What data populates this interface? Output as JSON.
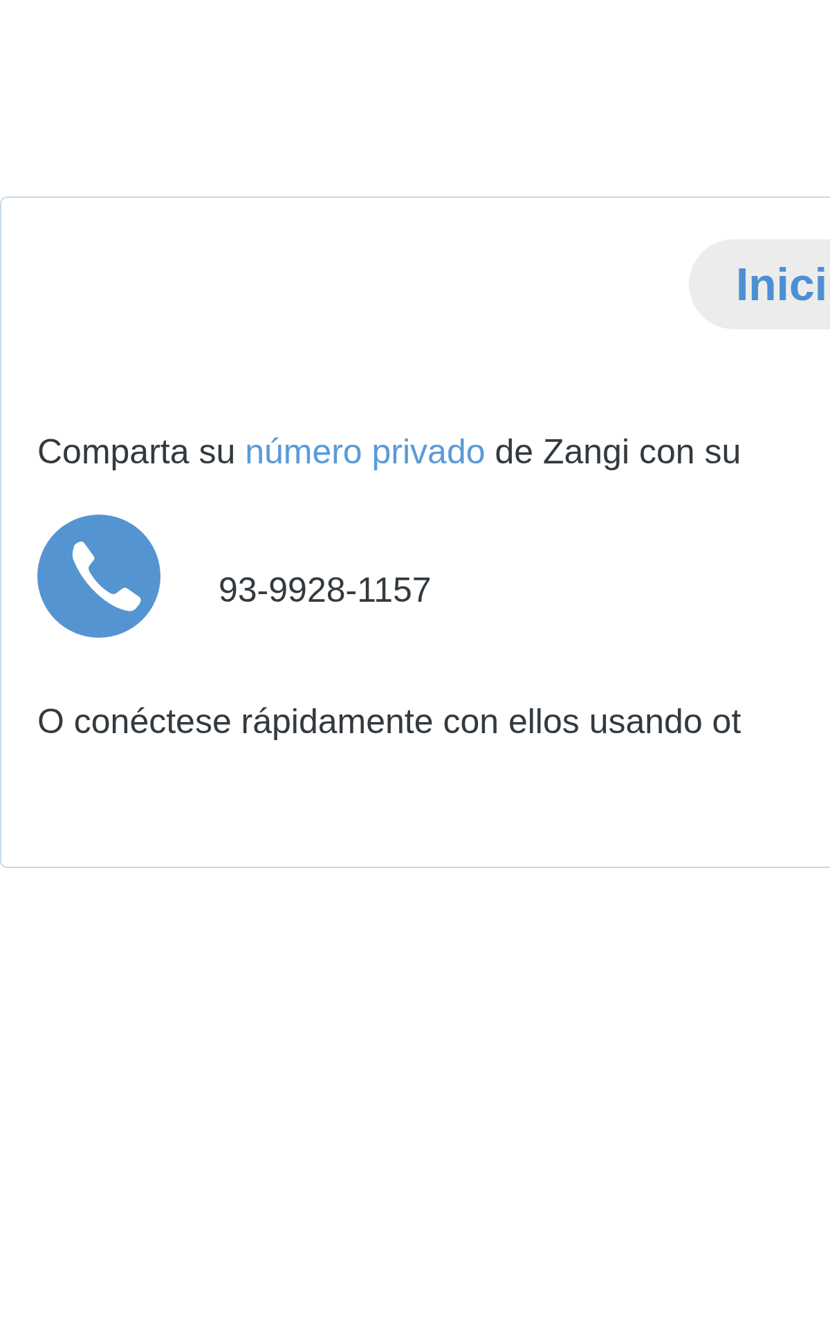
{
  "card": {
    "button": {
      "label": "Inici"
    },
    "share_text": {
      "before": "Comparta su ",
      "link": "número privado",
      "after": " de Zangi con su"
    },
    "phone_number": "93-9928-1157",
    "connect_text": "O conéctese rápidamente con ellos usando ot"
  }
}
